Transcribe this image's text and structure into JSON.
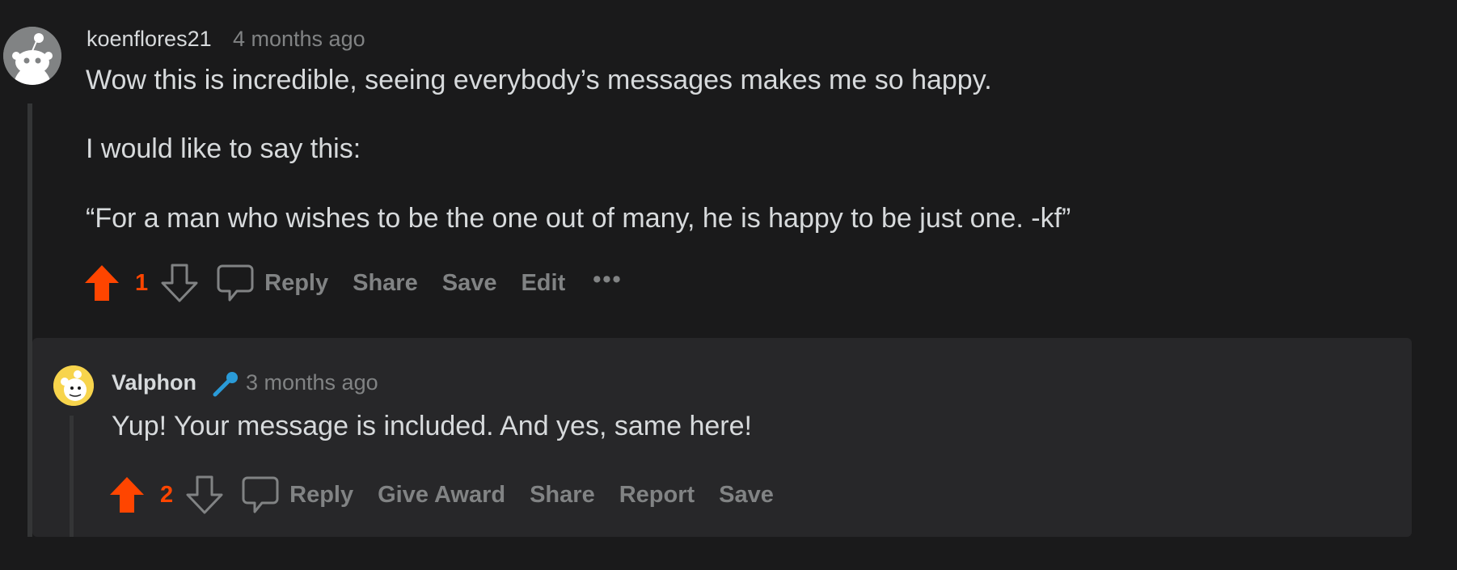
{
  "comment": {
    "author": "koenflores21",
    "time": "4 months ago",
    "paragraphs": [
      "Wow this is incredible, seeing everybody’s messages makes me so happy.",
      "I would like to say this:",
      "“For a man who wishes to be the one out of many, he is happy to be just one. -kf”"
    ],
    "score": "1",
    "actions": {
      "reply": "Reply",
      "share": "Share",
      "save": "Save",
      "edit": "Edit",
      "more": "•••"
    }
  },
  "reply": {
    "author": "Valphon",
    "time": "3 months ago",
    "text": "Yup! Your message is included. And yes, same here!",
    "score": "2",
    "actions": {
      "reply": "Reply",
      "give_award": "Give Award",
      "share": "Share",
      "report": "Report",
      "save": "Save"
    }
  },
  "colors": {
    "background": "#1a1a1b",
    "card": "#272729",
    "upvote": "#ff4500",
    "muted": "#818384",
    "text": "#d7dadc",
    "flair": "#2a9bd8"
  },
  "icons": {
    "upvote": "upvote-arrow-icon",
    "downvote": "downvote-arrow-icon",
    "comment": "comment-bubble-icon",
    "more": "more-options-icon",
    "flair": "microphone-icon"
  }
}
